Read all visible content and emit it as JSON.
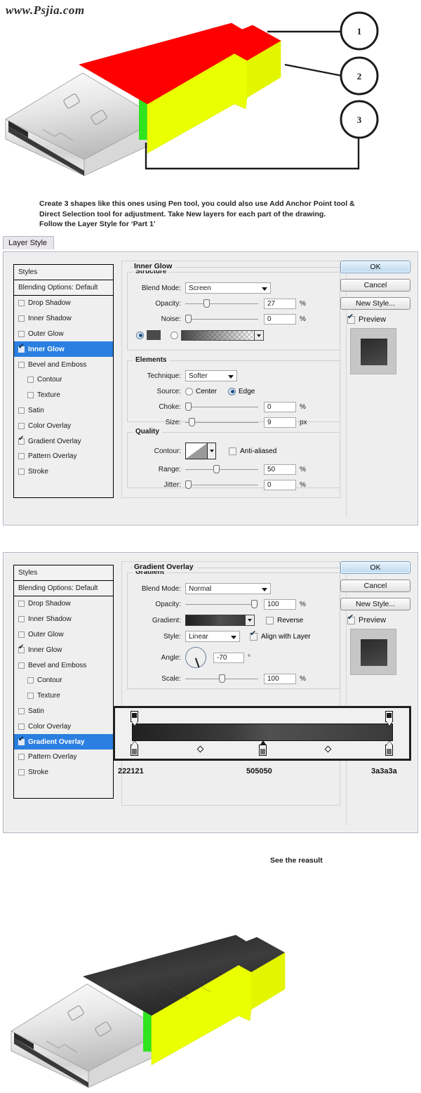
{
  "watermark": "www.Psjia.com",
  "top_illustration": {
    "callouts": [
      "1",
      "2",
      "3"
    ],
    "colors": {
      "part1": "#ff0000",
      "part2": "#eaff00",
      "part3": "#33ee22",
      "connector": "#e4e4e4"
    }
  },
  "instructions": {
    "line1": "Create 3 shapes like this ones using Pen tool, you could also use Add Anchor Point tool &",
    "line2": "Direct Selection tool for adjustment. Take New layers for each part of the drawing.",
    "line3": "Follow the Layer Style for ‘Part 1’"
  },
  "tab": {
    "label": "Layer Style"
  },
  "styles_panel": {
    "header": "Styles",
    "blending_options": "Blending Options: Default",
    "items": [
      {
        "label": "Drop Shadow",
        "checked": false,
        "indent": false
      },
      {
        "label": "Inner Shadow",
        "checked": false,
        "indent": false
      },
      {
        "label": "Outer Glow",
        "checked": false,
        "indent": false
      },
      {
        "label": "Inner Glow",
        "checked": true,
        "indent": false
      },
      {
        "label": "Bevel and Emboss",
        "checked": false,
        "indent": false
      },
      {
        "label": "Contour",
        "checked": false,
        "indent": true
      },
      {
        "label": "Texture",
        "checked": false,
        "indent": true
      },
      {
        "label": "Satin",
        "checked": false,
        "indent": false
      },
      {
        "label": "Color Overlay",
        "checked": false,
        "indent": false
      },
      {
        "label": "Gradient Overlay",
        "checked": true,
        "indent": false
      },
      {
        "label": "Pattern Overlay",
        "checked": false,
        "indent": false
      },
      {
        "label": "Stroke",
        "checked": false,
        "indent": false
      }
    ]
  },
  "buttons": {
    "ok": "OK",
    "cancel": "Cancel",
    "new_style": "New Style...",
    "preview": "Preview"
  },
  "inner_glow": {
    "section_title": "Inner Glow",
    "structure": {
      "legend": "Structure",
      "blend_mode_label": "Blend Mode:",
      "blend_mode_value": "Screen",
      "opacity_label": "Opacity:",
      "opacity_value": "27",
      "opacity_unit": "%",
      "noise_label": "Noise:",
      "noise_value": "0",
      "noise_unit": "%",
      "color_swatch": "#4a4a4a",
      "color_mode": "solid"
    },
    "elements": {
      "legend": "Elements",
      "technique_label": "Technique:",
      "technique_value": "Softer",
      "source_label": "Source:",
      "source_center": "Center",
      "source_edge": "Edge",
      "source_value": "Edge",
      "choke_label": "Choke:",
      "choke_value": "0",
      "choke_unit": "%",
      "size_label": "Size:",
      "size_value": "9",
      "size_unit": "px"
    },
    "quality": {
      "legend": "Quality",
      "contour_label": "Contour:",
      "anti_aliased_label": "Anti-aliased",
      "anti_aliased_checked": false,
      "range_label": "Range:",
      "range_value": "50",
      "range_unit": "%",
      "jitter_label": "Jitter:",
      "jitter_value": "0",
      "jitter_unit": "%"
    }
  },
  "gradient_overlay": {
    "section_title": "Gradient Overlay",
    "gradient": {
      "legend": "Gradient",
      "blend_mode_label": "Blend Mode:",
      "blend_mode_value": "Normal",
      "opacity_label": "Opacity:",
      "opacity_value": "100",
      "opacity_unit": "%",
      "gradient_label": "Gradient:",
      "reverse_label": "Reverse",
      "reverse_checked": false,
      "style_label": "Style:",
      "style_value": "Linear",
      "align_label": "Align with Layer",
      "align_checked": true,
      "angle_label": "Angle:",
      "angle_value": "-70",
      "angle_unit": "°",
      "scale_label": "Scale:",
      "scale_value": "100",
      "scale_unit": "%"
    }
  },
  "gradient_editor": {
    "stops": [
      {
        "hex": "222121",
        "position": 0
      },
      {
        "hex": "505050",
        "position": 50
      },
      {
        "hex": "3a3a3a",
        "position": 100
      }
    ],
    "labels": [
      "222121",
      "505050",
      "3a3a3a"
    ]
  },
  "result": {
    "caption": "See the reasult",
    "colors": {
      "body": "#2f2f2f",
      "side": "#eaff00",
      "edge": "#33ee22",
      "connector": "#e4e4e4"
    }
  }
}
